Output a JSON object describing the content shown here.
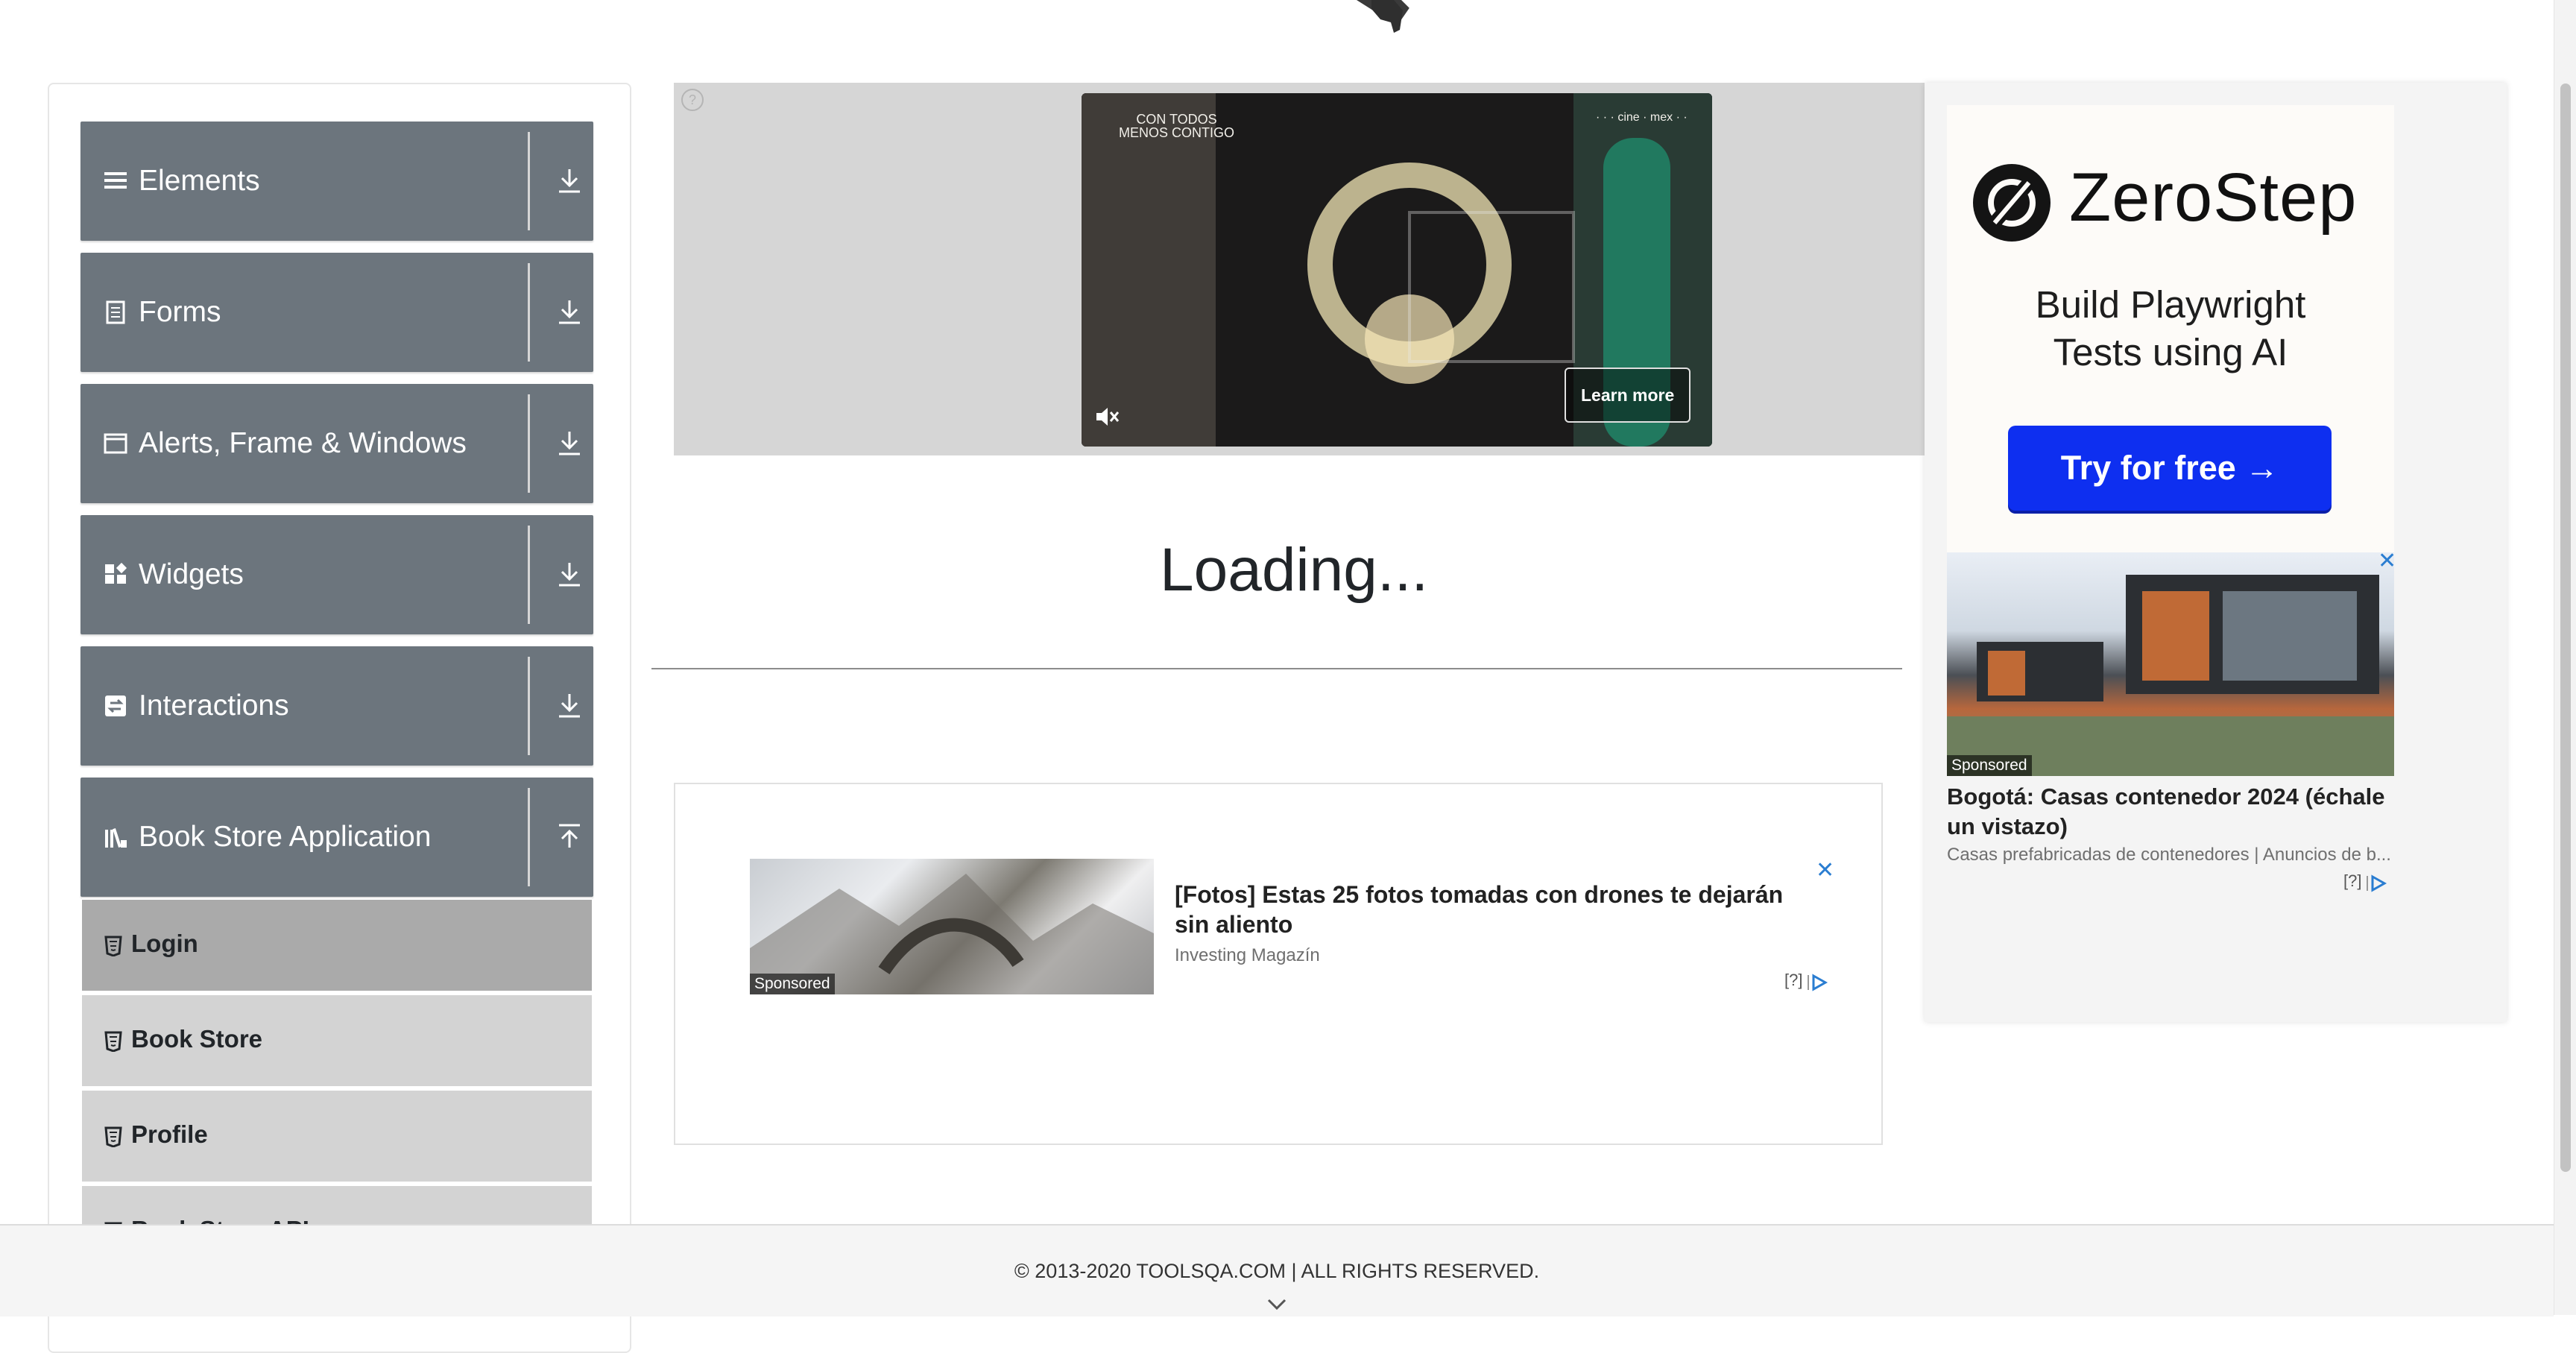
{
  "sidebar": {
    "groups": [
      {
        "label": "Elements",
        "icon": "hamburger-icon",
        "arrow": "download-arrow-icon"
      },
      {
        "label": "Forms",
        "icon": "form-icon",
        "arrow": "download-arrow-icon"
      },
      {
        "label": "Alerts, Frame & Windows",
        "icon": "window-icon",
        "arrow": "download-arrow-icon"
      },
      {
        "label": "Widgets",
        "icon": "widgets-icon",
        "arrow": "download-arrow-icon"
      },
      {
        "label": "Interactions",
        "icon": "interactions-icon",
        "arrow": "download-arrow-icon"
      },
      {
        "label": "Book Store Application",
        "icon": "library-icon",
        "arrow": "upload-arrow-icon"
      }
    ],
    "bookstore_items": [
      {
        "label": "Login",
        "active": true
      },
      {
        "label": "Book Store",
        "active": false
      },
      {
        "label": "Profile",
        "active": false
      },
      {
        "label": "Book Store API",
        "active": false
      }
    ]
  },
  "video_ad": {
    "info_label": "?",
    "corner_text": "CON TODOS\nMENOS CONTIGO",
    "brand_text": "· · · cine · mex · ·",
    "learn_more": "Learn more"
  },
  "main": {
    "loading_text": "Loading..."
  },
  "mid_ad": {
    "sponsored": "Sponsored",
    "title": "[Fotos] Estas 25 fotos tomadas con drones te dejarán sin aliento",
    "source": "Investing Magazín",
    "close": "✕",
    "adchoice": "[?]"
  },
  "right_ad": {
    "brand": "ZeroStep",
    "tagline_line1": "Build Playwright",
    "tagline_line2": "Tests using AI",
    "cta": "Try for free →",
    "sponsored": "Sponsored",
    "title": "Bogotá: Casas contenedor 2024 (échale un vistazo)",
    "source": "Casas prefabricadas de contenedores | Anuncios de b...",
    "close": "✕",
    "adchoice": "[?]",
    "brand_color": "#0e2ff0"
  },
  "footer": {
    "copyright": "© 2013-2020 TOOLSQA.COM | ALL RIGHTS RESERVED."
  },
  "colors": {
    "group_header_bg": "#6c757d",
    "menu_item_bg": "#d3d3d3",
    "menu_item_active_bg": "#aaaaaa",
    "ad_close_color": "#2a7dd1"
  }
}
